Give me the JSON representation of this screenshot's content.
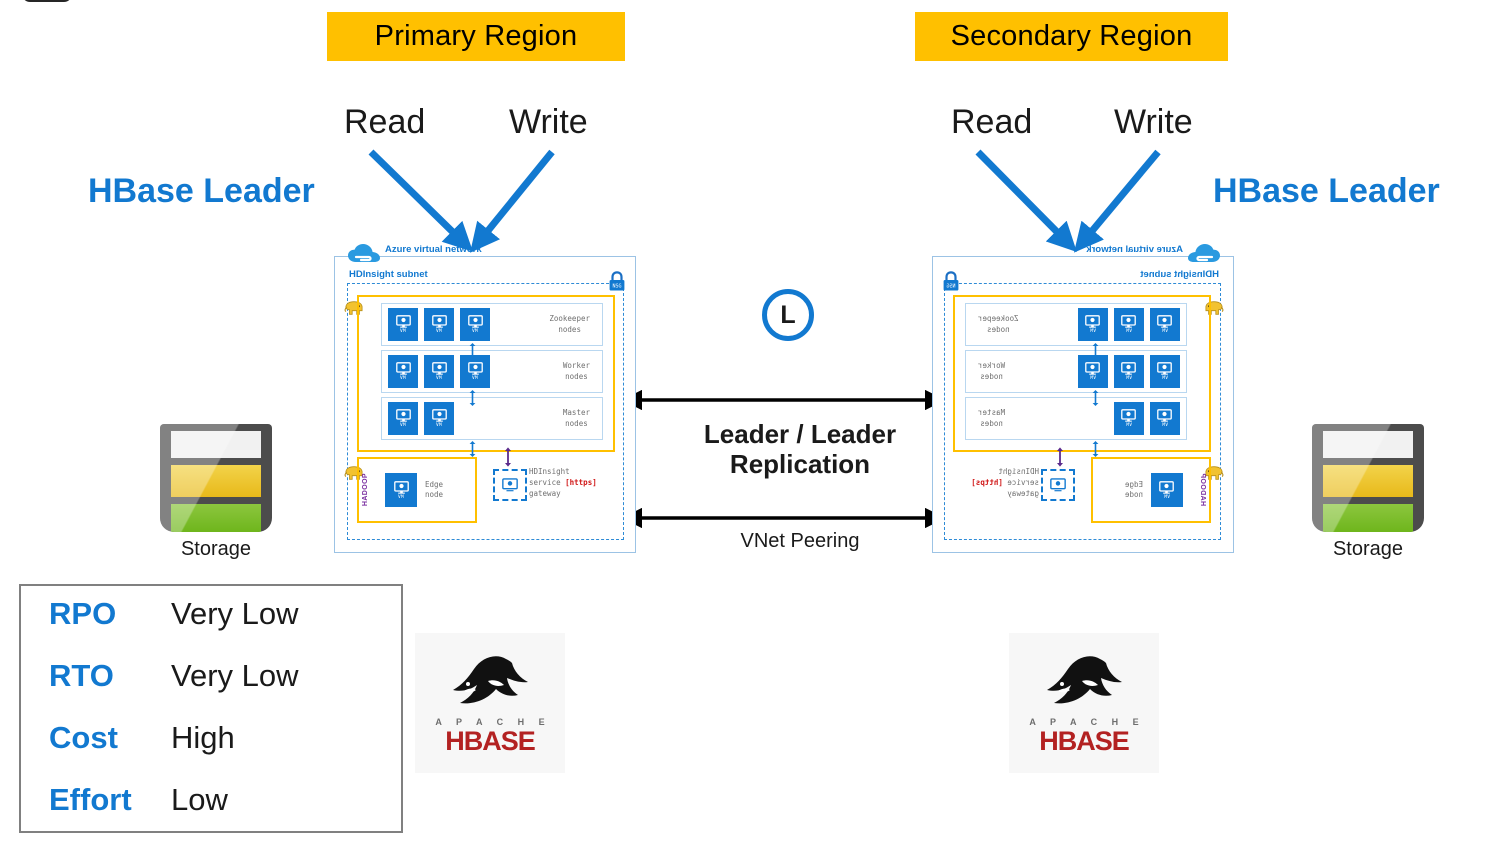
{
  "regions": {
    "primary": {
      "label": "Primary Region"
    },
    "secondary": {
      "label": "Secondary Region"
    }
  },
  "leader_labels": {
    "left": "HBase Leader",
    "right": "HBase Leader"
  },
  "traffic": {
    "primary": {
      "read": "Read",
      "write": "Write"
    },
    "secondary": {
      "read": "Read",
      "write": "Write"
    }
  },
  "middle": {
    "badge": "L",
    "replication_line1": "Leader / Leader",
    "replication_line2": "Replication",
    "vnet_peering": "VNet Peering"
  },
  "storage": {
    "left": {
      "caption": "Storage"
    },
    "right": {
      "caption": "Storage"
    }
  },
  "hbase_logo": {
    "apache": "A P A C H E",
    "name": "HBASE"
  },
  "metrics_table": {
    "rows": [
      {
        "key": "RPO",
        "value": "Very Low"
      },
      {
        "key": "RTO",
        "value": "Very Low"
      },
      {
        "key": "Cost",
        "value": "High"
      },
      {
        "key": "Effort",
        "value": "Low"
      }
    ]
  },
  "architecture": {
    "vnet_title": "Azure virtual network",
    "subnet_title": "HDInsight subnet",
    "nsg_label": "NSG",
    "hadoop_label": "HADOOP",
    "vm_tag": "VM",
    "rows": [
      {
        "name": "zookeeper",
        "line1": "Zookeeper",
        "line2": "nodes",
        "vm_count": 3
      },
      {
        "name": "worker",
        "line1": "Worker",
        "line2": "nodes",
        "vm_count": 3
      },
      {
        "name": "master",
        "line1": "Master",
        "line2": "nodes",
        "vm_count": 2
      }
    ],
    "edge": {
      "line1": "Edge",
      "line2": "node"
    },
    "gateway": {
      "line1": "HDInsight",
      "line2_pre": "service ",
      "line2_https": "[https]",
      "line3": "gateway"
    }
  },
  "colors": {
    "accent_blue": "#1279D0",
    "region_yellow": "#FFC000",
    "cluster_yellow": "#FFC000",
    "hbase_red": "#b32222",
    "hadoop_purple": "#7a2fa0",
    "https_red": "#d01717",
    "storage_green": "#68b215",
    "storage_yellow": "#e8b91a"
  }
}
